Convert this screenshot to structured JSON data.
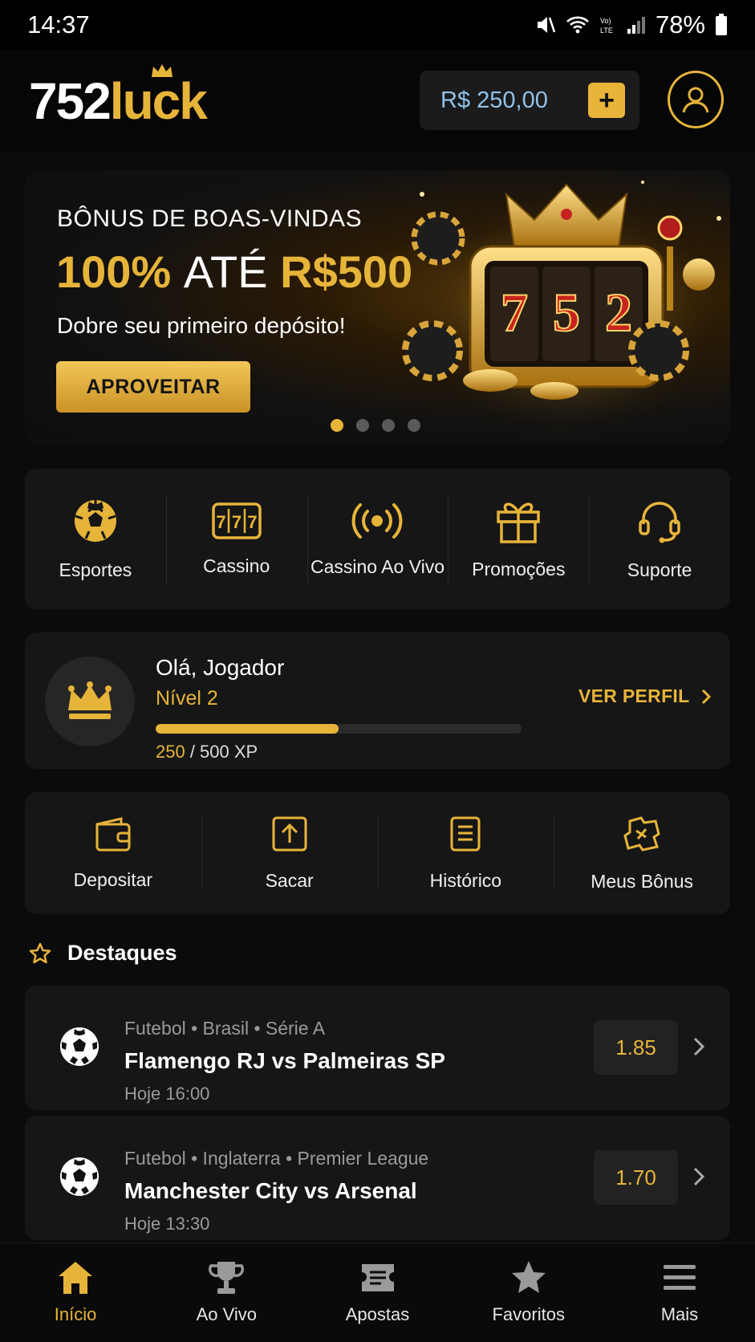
{
  "status_bar": {
    "time": "14:37",
    "battery": "78%"
  },
  "header": {
    "logo_number": "752",
    "logo_word": "luck",
    "balance": "R$ 250,00",
    "add_funds_label": "+"
  },
  "banner": {
    "kicker": "BÔNUS DE BOAS-VINDAS",
    "headline_percent": "100%",
    "headline_mid": "ATÉ",
    "headline_amount": "R$500",
    "subtitle": "Dobre seu primeiro depósito!",
    "cta": "APROVEITAR",
    "slot_digits": [
      "7",
      "5",
      "2"
    ],
    "slides_total": 4,
    "active_slide": 1
  },
  "categories": [
    {
      "label": "Esportes",
      "icon": "soccer-ball-icon"
    },
    {
      "label": "Cassino",
      "icon": "slot-777-icon"
    },
    {
      "label": "Cassino Ao Vivo",
      "icon": "live-broadcast-icon"
    },
    {
      "label": "Promoções",
      "icon": "gift-icon"
    },
    {
      "label": "Suporte",
      "icon": "headset-icon"
    }
  ],
  "player": {
    "greeting": "Olá, Jogador",
    "level": "Nível 2",
    "xp_current": "250",
    "xp_rest": " / 500 XP",
    "xp_fraction": 0.5,
    "profile_link": "VER PERFIL"
  },
  "actions": [
    {
      "label": "Depositar",
      "icon": "wallet-icon"
    },
    {
      "label": "Sacar",
      "icon": "upload-icon"
    },
    {
      "label": "Histórico",
      "icon": "document-icon"
    },
    {
      "label": "Meus Bônus",
      "icon": "bonus-ticket-icon"
    }
  ],
  "highlights": {
    "title": "Destaques",
    "matches": [
      {
        "league": "Futebol • Brasil • Série A",
        "teams": "Flamengo RJ vs Palmeiras SP",
        "time": "Hoje 16:00",
        "odd": "1.85"
      },
      {
        "league": "Futebol • Inglaterra • Premier League",
        "teams": "Manchester City vs Arsenal",
        "time": "Hoje 13:30",
        "odd": "1.70"
      }
    ]
  },
  "bottom_nav": [
    {
      "label": "Início",
      "icon": "home-icon",
      "active": true
    },
    {
      "label": "Ao Vivo",
      "icon": "trophy-icon",
      "active": false
    },
    {
      "label": "Apostas",
      "icon": "ticket-icon",
      "active": false
    },
    {
      "label": "Favoritos",
      "icon": "star-icon",
      "active": false
    },
    {
      "label": "Mais",
      "icon": "menu-icon",
      "active": false
    }
  ],
  "colors": {
    "accent": "#e7b43a",
    "background": "#0b0b0b",
    "card": "#161616",
    "balance_text": "#8fc2ea"
  }
}
